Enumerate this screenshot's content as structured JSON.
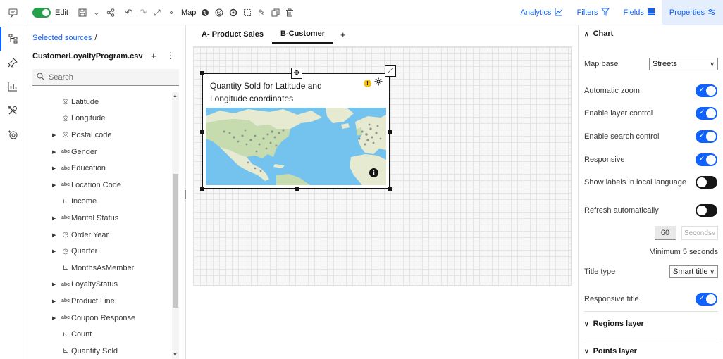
{
  "toolbar": {
    "edit_label": "Edit",
    "map_label": "Map",
    "analytics_label": "Analytics",
    "filters_label": "Filters",
    "fields_label": "Fields",
    "properties_label": "Properties"
  },
  "data_panel": {
    "breadcrumb": "Selected sources",
    "breadcrumb_sep": "/",
    "source_name": "CustomerLoyaltyProgram.csv",
    "add_label": "+",
    "more_label": "⋮",
    "search_placeholder": "Search",
    "fields": [
      {
        "name": "Latitude",
        "type": "location",
        "expandable": false
      },
      {
        "name": "Longitude",
        "type": "location",
        "expandable": false
      },
      {
        "name": "Postal code",
        "type": "location",
        "expandable": true
      },
      {
        "name": "Gender",
        "type": "abc",
        "expandable": true
      },
      {
        "name": "Education",
        "type": "abc",
        "expandable": true
      },
      {
        "name": "Location Code",
        "type": "abc",
        "expandable": true
      },
      {
        "name": "Income",
        "type": "measure",
        "expandable": false
      },
      {
        "name": "Marital Status",
        "type": "abc",
        "expandable": true
      },
      {
        "name": "Order Year",
        "type": "time",
        "expandable": true
      },
      {
        "name": "Quarter",
        "type": "time",
        "expandable": true
      },
      {
        "name": "MonthsAsMember",
        "type": "measure",
        "expandable": false
      },
      {
        "name": "LoyaltyStatus",
        "type": "abc",
        "expandable": true
      },
      {
        "name": "Product Line",
        "type": "abc",
        "expandable": true
      },
      {
        "name": "Coupon Response",
        "type": "abc",
        "expandable": true
      },
      {
        "name": "Count",
        "type": "measure",
        "expandable": false
      },
      {
        "name": "Quantity Sold",
        "type": "measure",
        "expandable": false
      }
    ],
    "type_glyphs": {
      "location": "◎",
      "abc": "abc",
      "measure": "⊾",
      "time": "◷"
    }
  },
  "canvas": {
    "tabs": [
      {
        "label": "A- Product Sales",
        "active": false
      },
      {
        "label": "B-Customer",
        "active": true
      }
    ],
    "add_tab_label": "+",
    "widget": {
      "title": "Quantity Sold for Latitude and Longitude coordinates",
      "warning_glyph": "!",
      "info_glyph": "i"
    }
  },
  "properties": {
    "chart_section": "Chart",
    "map_base_label": "Map base",
    "map_base_value": "Streets",
    "automatic_zoom_label": "Automatic zoom",
    "automatic_zoom_on": true,
    "layer_control_label": "Enable layer control",
    "layer_control_on": true,
    "search_control_label": "Enable search control",
    "search_control_on": true,
    "responsive_label": "Responsive",
    "responsive_on": true,
    "local_language_label": "Show labels in local language",
    "local_language_on": false,
    "refresh_label": "Refresh automatically",
    "refresh_on": false,
    "refresh_value": "60",
    "refresh_unit": "Seconds",
    "refresh_minimum": "Minimum 5 seconds",
    "title_type_label": "Title type",
    "title_type_value": "Smart title",
    "responsive_title_label": "Responsive title",
    "responsive_title_on": true,
    "regions_layer": "Regions layer",
    "points_layer": "Points layer"
  },
  "colors": {
    "accent": "#0f62fe",
    "edit_toggle": "#24a148",
    "water": "#74c3ee",
    "land": "#e6ead0",
    "land_green": "#c6dcae",
    "warning": "#f1c21b"
  }
}
